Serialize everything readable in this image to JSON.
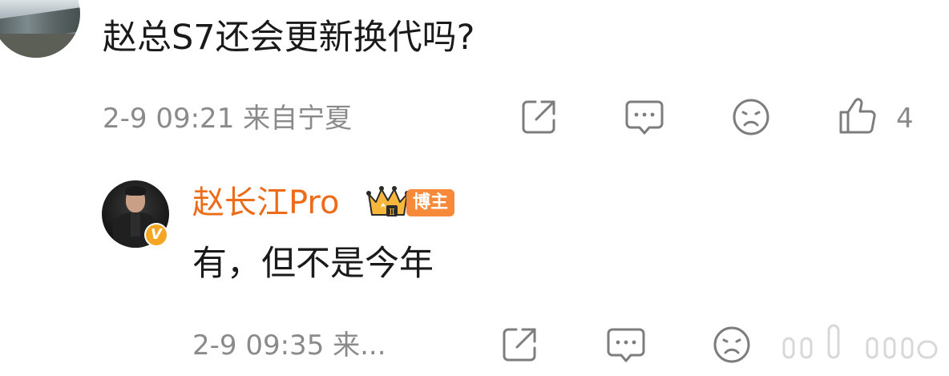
{
  "comment": {
    "text": "赵总S7还会更新换代吗?",
    "meta": "2-9 09:21  来自宁夏",
    "like_count": "4",
    "actions": [
      "share-icon",
      "comment-icon",
      "dislike-icon",
      "like-icon"
    ]
  },
  "reply": {
    "username": "赵长江Pro",
    "badge": "博主",
    "crown_level": "Ⅱ",
    "verify_mark": "V",
    "text": "有，但不是今年",
    "meta": "2-9 09:35  来...",
    "actions": [
      "share-icon",
      "comment-icon",
      "dislike-icon"
    ]
  },
  "colors": {
    "username": "#ec6c1a",
    "badge": "#f7893a",
    "verify": "#f5a623",
    "meta": "#8a8a8a",
    "text": "#1a1a1a"
  }
}
